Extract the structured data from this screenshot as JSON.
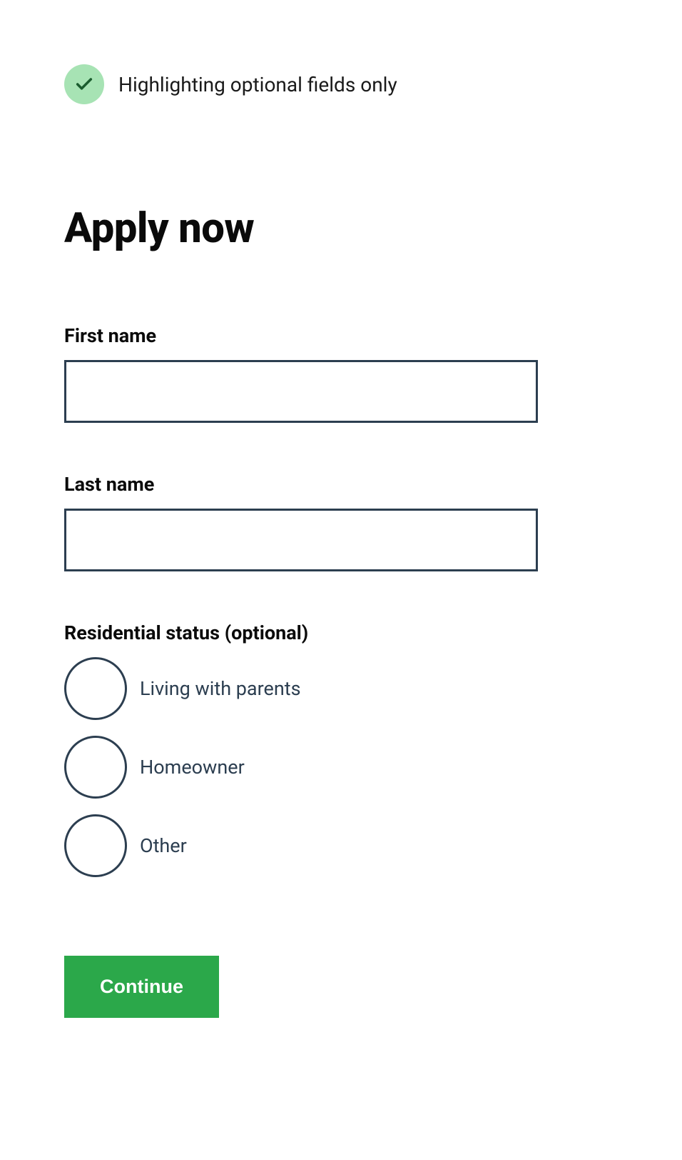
{
  "notification": {
    "text": "Highlighting optional fields only"
  },
  "heading": "Apply now",
  "fields": {
    "first_name": {
      "label": "First name",
      "value": ""
    },
    "last_name": {
      "label": "Last name",
      "value": ""
    },
    "residential_status": {
      "label": "Residential status (optional)",
      "options": [
        "Living with parents",
        "Homeowner",
        "Other"
      ]
    }
  },
  "submit_label": "Continue"
}
